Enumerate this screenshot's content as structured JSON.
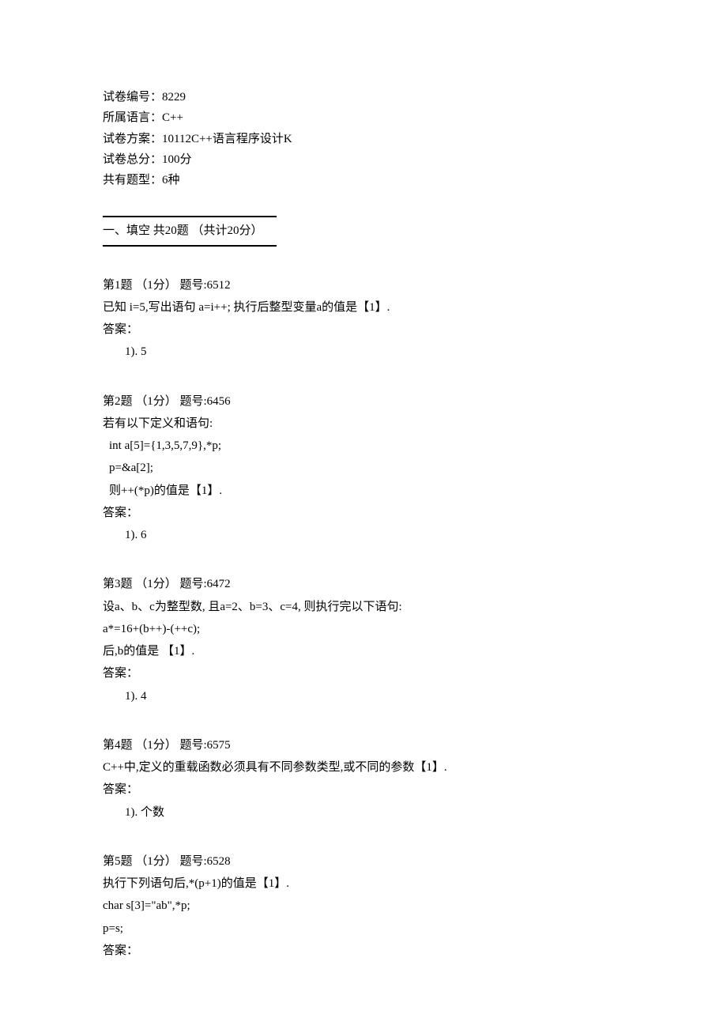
{
  "header": {
    "exam_id_label": "试卷编号：",
    "exam_id_value": "8229",
    "language_label": "所属语言：",
    "language_value": "C++",
    "scheme_label": "试卷方案：",
    "scheme_value": "10112C++语言程序设计K",
    "total_score_label": "试卷总分：",
    "total_score_value": "100分",
    "type_count_label": "共有题型：",
    "type_count_value": "6种"
  },
  "section": {
    "title": "一、填空   共20题 （共计20分）"
  },
  "q1": {
    "header": "第1题 （1分）   题号:6512",
    "body": "已知 i=5,写出语句 a=i++; 执行后整型变量a的值是【1】.",
    "answer_label": "答案：",
    "answer": "1). 5"
  },
  "q2": {
    "header": "第2题 （1分）   题号:6456",
    "body1": "若有以下定义和语句:",
    "body2": " int a[5]={1,3,5,7,9},*p;",
    "body3": " p=&a[2];",
    "body4": " 则++(*p)的值是【1】.",
    "answer_label": "答案：",
    "answer": "1). 6"
  },
  "q3": {
    "header": "第3题 （1分）   题号:6472",
    "body1": "设a、b、c为整型数, 且a=2、b=3、c=4, 则执行完以下语句:",
    "body2": "a*=16+(b++)-(++c);",
    "body3": "后,b的值是 【1】.",
    "answer_label": "答案：",
    "answer": "1). 4"
  },
  "q4": {
    "header": "第4题 （1分）   题号:6575",
    "body": "C++中,定义的重载函数必须具有不同参数类型,或不同的参数【1】.",
    "answer_label": "答案：",
    "answer": "1). 个数"
  },
  "q5": {
    "header": "第5题 （1分）   题号:6528",
    "body1": "执行下列语句后,*(p+1)的值是【1】.",
    "body2": "char  s[3]=\"ab\",*p;",
    "body3": "p=s;",
    "answer_label": "答案："
  }
}
